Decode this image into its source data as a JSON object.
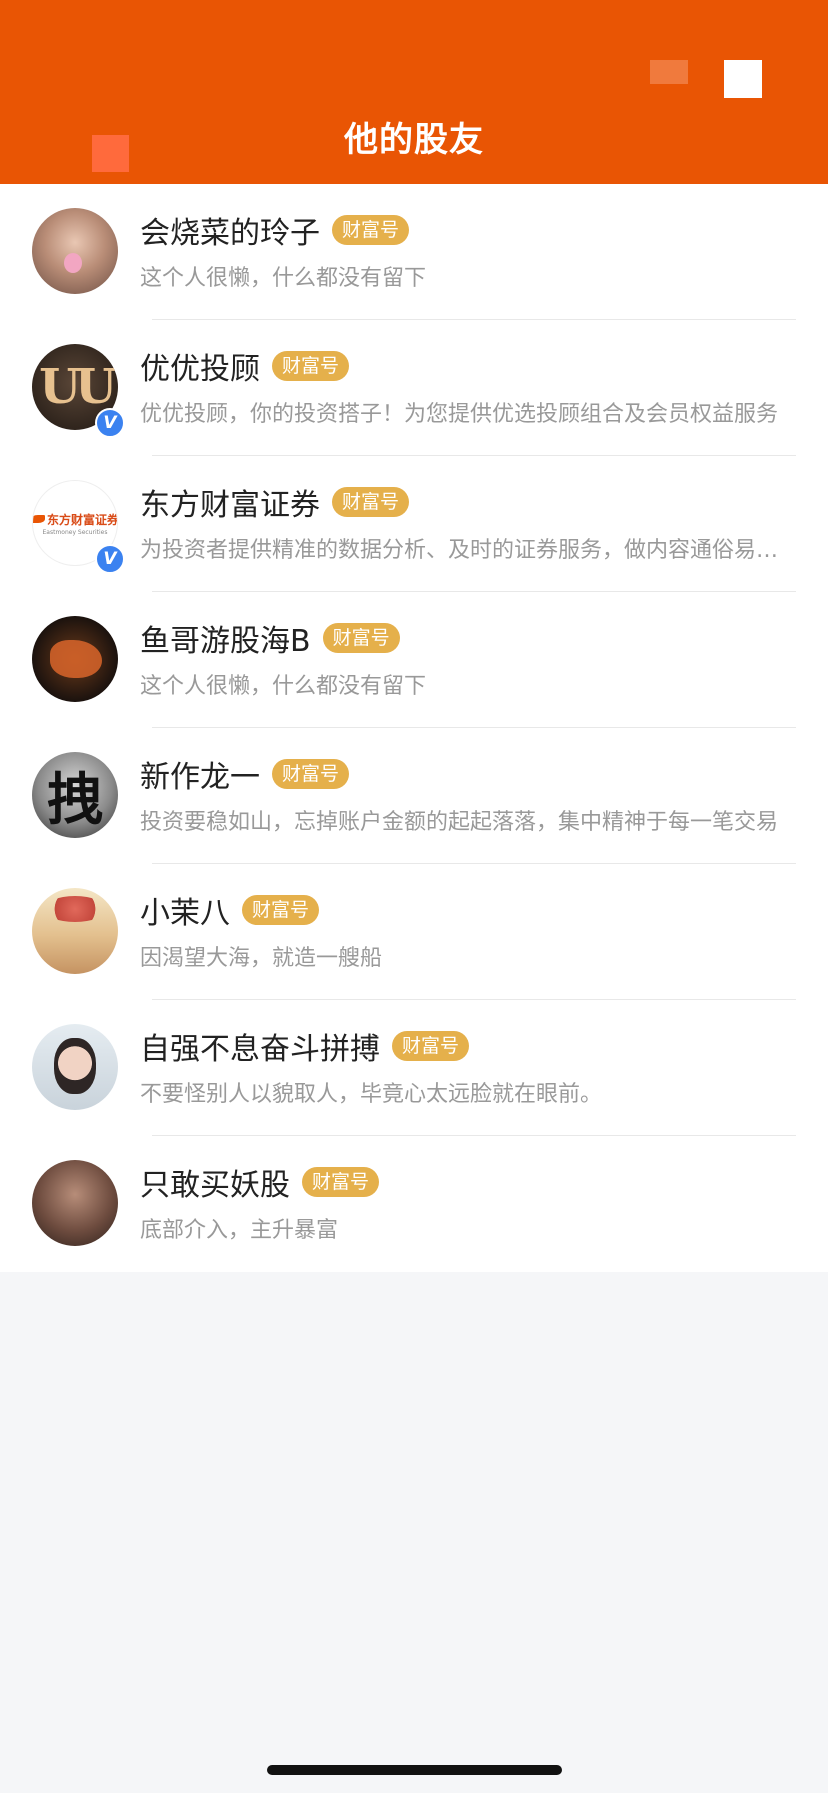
{
  "header": {
    "title": "他的股友"
  },
  "badge_label": "财富号",
  "friends": [
    {
      "name": "会烧菜的玲子",
      "description": "这个人很懒，什么都没有留下",
      "verified": false
    },
    {
      "name": "优优投顾",
      "description": "优优投顾，你的投资搭子！为您提供优选投顾组合及会员权益服务",
      "verified": true,
      "avatar_text": "UU"
    },
    {
      "name": "东方财富证券",
      "description": "为投资者提供精准的数据分析、及时的证券服务，做内容通俗易懂的财经号",
      "verified": true,
      "avatar_text": "东方财富证券",
      "avatar_subtext": "Eastmoney Securities"
    },
    {
      "name": "鱼哥游股海B",
      "description": "这个人很懒，什么都没有留下",
      "verified": false
    },
    {
      "name": "新作龙一",
      "description": "投资要稳如山，忘掉账户金额的起起落落，集中精神于每一笔交易",
      "verified": false,
      "avatar_text": "拽"
    },
    {
      "name": "小茉八",
      "description": "因渴望大海，就造一艘船",
      "verified": false
    },
    {
      "name": "自强不息奋斗拼搏",
      "description": "不要怪别人以貌取人，毕竟心太远脸就在眼前。",
      "verified": false
    },
    {
      "name": "只敢买妖股",
      "description": "底部介入，主升暴富",
      "verified": false
    }
  ],
  "colors": {
    "header_bg": "#e95504",
    "badge_bg": "#e5b04b",
    "verified_bg": "#3b82f0"
  }
}
